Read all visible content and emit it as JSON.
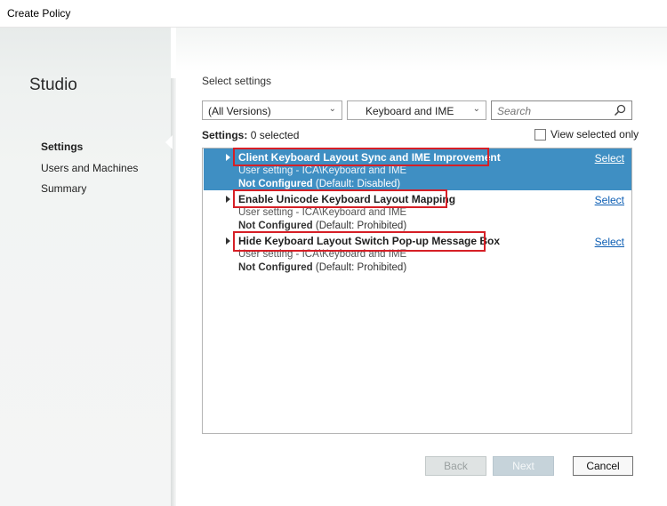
{
  "window": {
    "title": "Create Policy"
  },
  "sidebar": {
    "app_name": "Studio",
    "items": [
      {
        "label": "Settings",
        "active": true
      },
      {
        "label": "Users and Machines",
        "active": false
      },
      {
        "label": "Summary",
        "active": false
      }
    ]
  },
  "main": {
    "section_title": "Select settings",
    "version_filter": "(All Versions)",
    "category_filter": "Keyboard and IME",
    "search_placeholder": "Search",
    "settings_label": "Settings:",
    "settings_count": "0 selected",
    "view_selected_label": "View selected only",
    "rows": [
      {
        "name": "Client Keyboard Layout Sync and IME Improvement",
        "scope": "User setting - ICA\\Keyboard and IME",
        "status_bold": "Not Configured",
        "status_default": "(Default: Disabled)",
        "select_label": "Select",
        "selected": true
      },
      {
        "name": "Enable Unicode Keyboard Layout Mapping",
        "scope": "User setting - ICA\\Keyboard and IME",
        "status_bold": "Not Configured",
        "status_default": "(Default: Prohibited)",
        "select_label": "Select",
        "selected": false
      },
      {
        "name": "Hide Keyboard Layout Switch Pop-up Message Box",
        "scope": "User setting - ICA\\Keyboard and IME",
        "status_bold": "Not Configured",
        "status_default": "(Default: Prohibited)",
        "select_label": "Select",
        "selected": false
      }
    ]
  },
  "footer": {
    "back_label": "Back",
    "next_label": "Next",
    "cancel_label": "Cancel"
  },
  "colors": {
    "selection": "#3f8fc3",
    "highlight_border": "#d61f26",
    "link": "#0b5db3"
  },
  "icons": {
    "search": "search-icon",
    "dropdown": "chevron-down-icon",
    "expand": "expand-arrow-icon"
  }
}
